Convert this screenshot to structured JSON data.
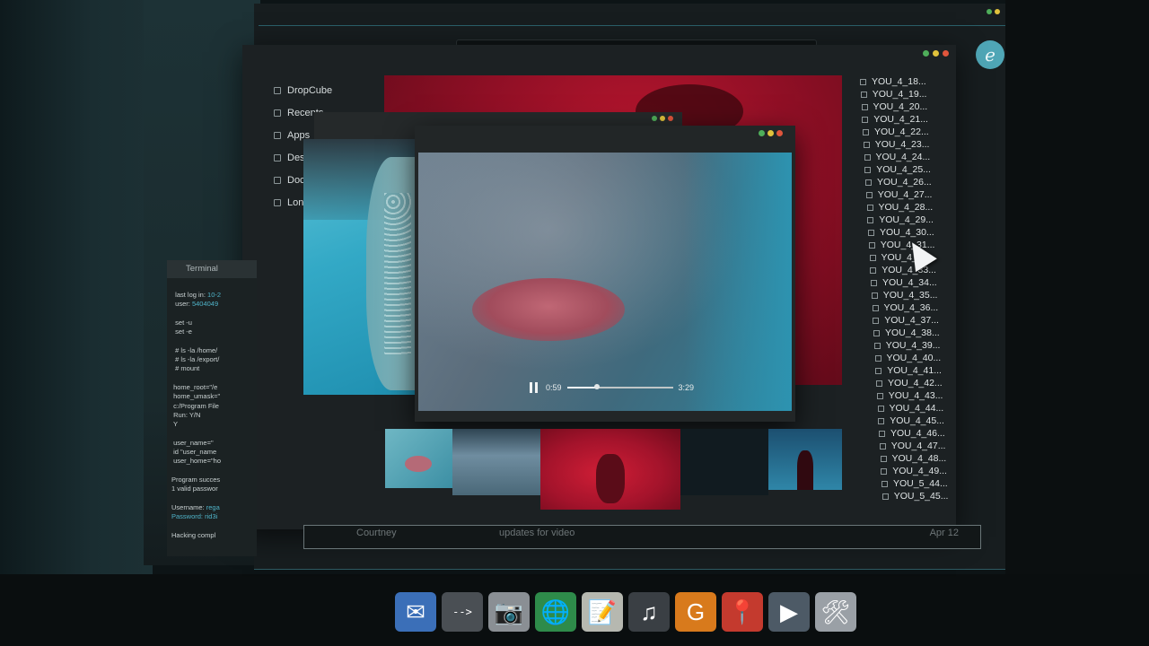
{
  "colors": {
    "accent": "#2a5f69",
    "traffic_green": "#4fae5a",
    "traffic_yellow": "#e0c23c",
    "traffic_red": "#e0553c",
    "highlight": "#4fb3c8"
  },
  "brand_badge": "e",
  "sidebar": {
    "items": [
      {
        "label": "DropCube",
        "icon": "cloud-icon"
      },
      {
        "label": "Recents",
        "icon": "clock-icon"
      },
      {
        "label": "Apps",
        "icon": "apps-icon"
      },
      {
        "label": "Deskt",
        "icon": "desktop-icon"
      },
      {
        "label": "Docu",
        "icon": "document-icon"
      },
      {
        "label": "Londo",
        "icon": "folder-icon"
      }
    ]
  },
  "file_list": [
    "YOU_4_18...",
    "YOU_4_19...",
    "YOU_4_20...",
    "YOU_4_21...",
    "YOU_4_22...",
    "YOU_4_23...",
    "YOU_4_24...",
    "YOU_4_25...",
    "YOU_4_26...",
    "YOU_4_27...",
    "YOU_4_28...",
    "YOU_4_29...",
    "YOU_4_30...",
    "YOU_4_31...",
    "YOU_4_32...",
    "YOU_4_33...",
    "YOU_4_34...",
    "YOU_4_35...",
    "YOU_4_36...",
    "YOU_4_37...",
    "YOU_4_38...",
    "YOU_4_39...",
    "YOU_4_40...",
    "YOU_4_41...",
    "YOU_4_42...",
    "YOU_4_43...",
    "YOU_4_44...",
    "YOU_4_45...",
    "YOU_4_46...",
    "YOU_4_47...",
    "YOU_4_48...",
    "YOU_4_49...",
    "YOU_5_44...",
    "YOU_5_45..."
  ],
  "player": {
    "current_time": "0:59",
    "duration": "3:29",
    "progress": 0.28
  },
  "mail_row": {
    "sender": "Courtney",
    "subject": "updates for video",
    "date": "Apr 12"
  },
  "terminal": {
    "title": "Terminal",
    "lines": [
      {
        "text": "  last log in: ",
        "hl": "10-2"
      },
      {
        "text": "  user: ",
        "hl": "5404049"
      },
      {
        "text": ""
      },
      {
        "text": "  set -u"
      },
      {
        "text": "  set -e"
      },
      {
        "text": ""
      },
      {
        "text": "  # ls -la /home/"
      },
      {
        "text": "  # ls -la /export/"
      },
      {
        "text": "  # mount"
      },
      {
        "text": ""
      },
      {
        "text": " home_root=\"/e"
      },
      {
        "text": " home_umask=\""
      },
      {
        "text": " c:/Program File"
      },
      {
        "text": " Run: Y/N"
      },
      {
        "text": " Y"
      },
      {
        "text": ""
      },
      {
        "text": " user_name=\""
      },
      {
        "text": " id \"user_name"
      },
      {
        "text": " user_home=\"ho"
      },
      {
        "text": ""
      },
      {
        "text": "Program succes"
      },
      {
        "text": "1 valid passwor"
      },
      {
        "text": ""
      },
      {
        "text": "Username: ",
        "hl": "rega"
      },
      {
        "text": "Password: ",
        "hl": "rid3i",
        "label_hl": true
      },
      {
        "text": ""
      },
      {
        "text": "Hacking compl"
      }
    ]
  },
  "dock": [
    {
      "name": "mail-icon",
      "glyph": "✉",
      "bg": "#3b6fb8"
    },
    {
      "name": "terminal-icon",
      "glyph": "-->",
      "bg": "#4a4f54"
    },
    {
      "name": "camera-icon",
      "glyph": "📷",
      "bg": "#8a8f94"
    },
    {
      "name": "browser-globe-icon",
      "glyph": "🌐",
      "bg": "#2e8b4a"
    },
    {
      "name": "notes-icon",
      "glyph": "📝",
      "bg": "#b6b8b0"
    },
    {
      "name": "music-icon",
      "glyph": "♫",
      "bg": "#3a3f44"
    },
    {
      "name": "app-g-icon",
      "glyph": "G",
      "bg": "#d87a1c"
    },
    {
      "name": "maps-pin-icon",
      "glyph": "📍",
      "bg": "#c43a2e"
    },
    {
      "name": "video-player-icon",
      "glyph": "▶",
      "bg": "#4d5a66"
    },
    {
      "name": "settings-tools-icon",
      "glyph": "🛠",
      "bg": "#9aa0a6"
    }
  ]
}
